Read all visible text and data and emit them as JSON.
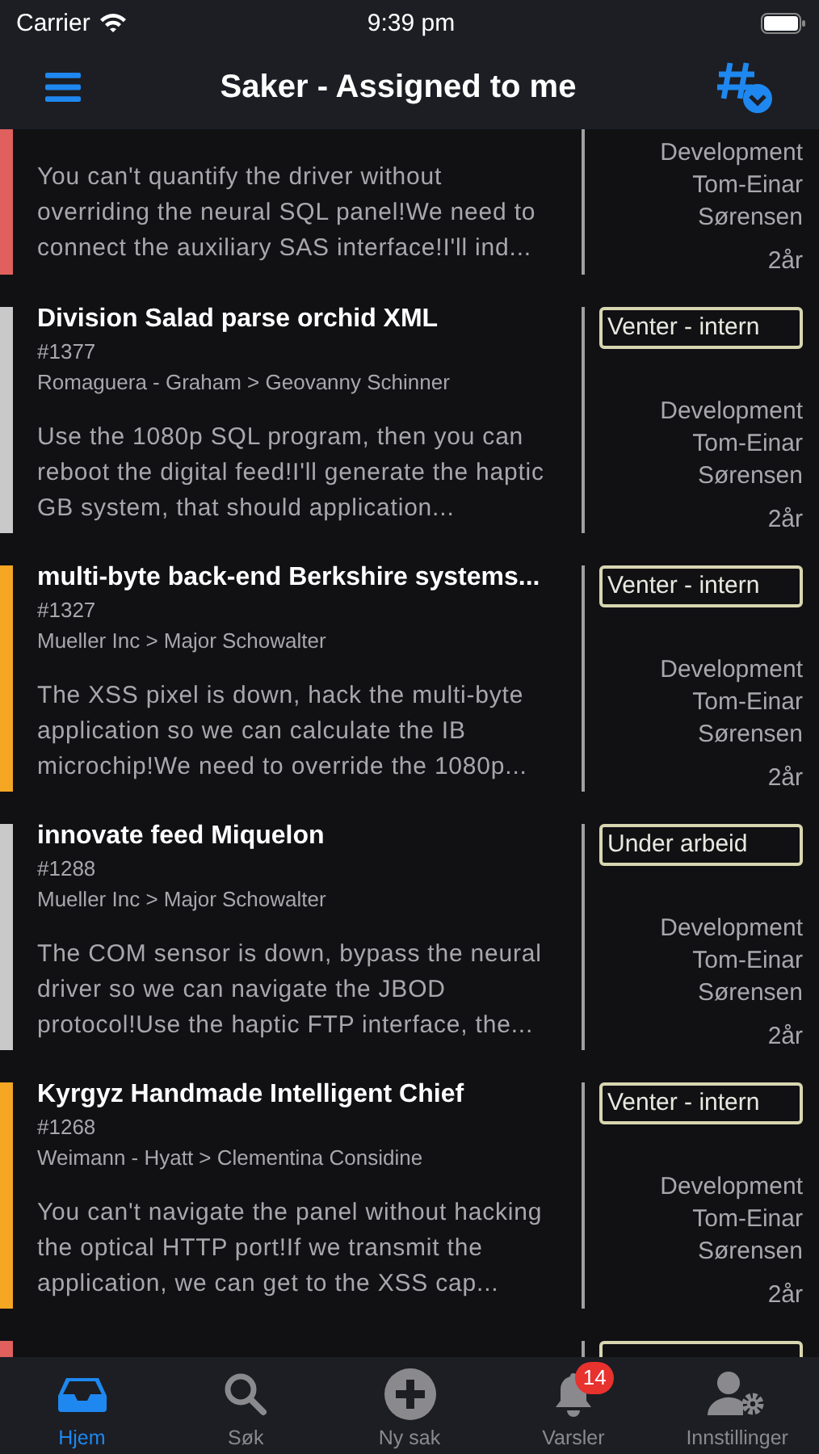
{
  "status_bar": {
    "carrier": "Carrier",
    "time": "9:39 pm"
  },
  "header": {
    "title": "Saker - Assigned to me"
  },
  "cases": [
    {
      "kind": "partial",
      "color": "#e0605e",
      "description": "You can't quantify the driver without overriding the neural SQL panel!We need to connect the auxiliary SAS interface!I'll ind...",
      "team": "Development",
      "assignee": "Tom-Einar Sørensen",
      "age": "2år"
    },
    {
      "kind": "full",
      "color": "#c9c9c9",
      "title": "Division Salad parse orchid XML",
      "number": "#1377",
      "path": "Romaguera - Graham > Geovanny Schinner",
      "description": "Use the 1080p SQL program, then you can reboot the digital feed!I'll generate the haptic GB system, that should application...",
      "status": "Venter - intern",
      "team": "Development",
      "assignee": "Tom-Einar Sørensen",
      "age": "2år"
    },
    {
      "kind": "full",
      "color": "#f5a623",
      "title": "multi-byte back-end Berkshire systems...",
      "number": "#1327",
      "path": "Mueller Inc > Major Schowalter",
      "description": "The XSS pixel is down, hack the multi-byte application so we can calculate the IB microchip!We need to override the 1080p...",
      "status": "Venter - intern",
      "team": "Development",
      "assignee": "Tom-Einar Sørensen",
      "age": "2år"
    },
    {
      "kind": "full",
      "color": "#c9c9c9",
      "title": "innovate feed Miquelon",
      "number": "#1288",
      "path": "Mueller Inc > Major Schowalter",
      "description": "The COM sensor is down, bypass the neural driver so we can navigate the JBOD protocol!Use the haptic FTP interface, the...",
      "status": "Under arbeid",
      "team": "Development",
      "assignee": "Tom-Einar Sørensen",
      "age": "2år"
    },
    {
      "kind": "full",
      "color": "#f5a623",
      "title": "Kyrgyz Handmade Intelligent Chief",
      "number": "#1268",
      "path": "Weimann - Hyatt > Clementina Considine",
      "description": "You can't navigate the panel without hacking the optical HTTP port!If we transmit the application, we can get to the XSS cap...",
      "status": "Venter - intern",
      "team": "Development",
      "assignee": "Tom-Einar Sørensen",
      "age": "2år"
    },
    {
      "kind": "cut",
      "color": "#e0605e"
    }
  ],
  "tabs": [
    {
      "label": "Hjem",
      "selected": true
    },
    {
      "label": "Søk",
      "selected": false
    },
    {
      "label": "Ny sak",
      "selected": false
    },
    {
      "label": "Varsler",
      "selected": false,
      "badge": "14"
    },
    {
      "label": "Innstillinger",
      "selected": false
    }
  ]
}
